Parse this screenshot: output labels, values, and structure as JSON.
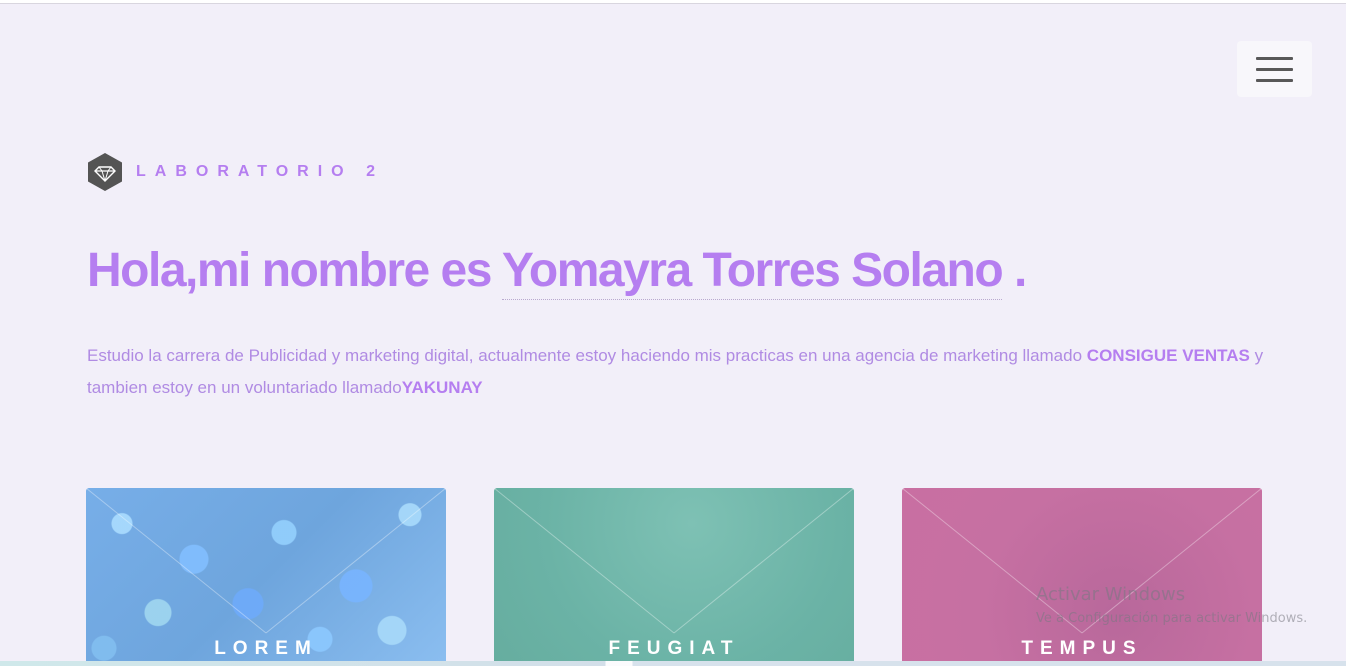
{
  "header": {
    "brand": "LABORATORIO 2",
    "menu_icon": "hamburger-menu-icon",
    "logo_icon": "diamond-hexagon-icon"
  },
  "hero": {
    "greeting": "Hola,mi nombre es",
    "name": "Yomayra Torres Solano",
    "period": "."
  },
  "intro": {
    "text1": "Estudio la carrera de Publicidad y marketing digital, actualmente estoy haciendo mis practicas en una agencia de marketing llamado",
    "highlight1": "CONSIGUE VENTAS",
    "text2": "y tambien estoy en un voluntariado llamado",
    "highlight2": "YAKUNAY"
  },
  "cards": [
    {
      "label": "LOREM",
      "color": "#77aee8"
    },
    {
      "label": "FEUGIAT",
      "color": "#6bb3a6"
    },
    {
      "label": "TEMPUS",
      "color": "#c670a2"
    }
  ],
  "watermark": {
    "title": "Activar Windows",
    "subtitle": "Ve a Configuración para activar Windows."
  },
  "colors": {
    "accent": "#b57ef0",
    "background": "#f2eff9"
  }
}
